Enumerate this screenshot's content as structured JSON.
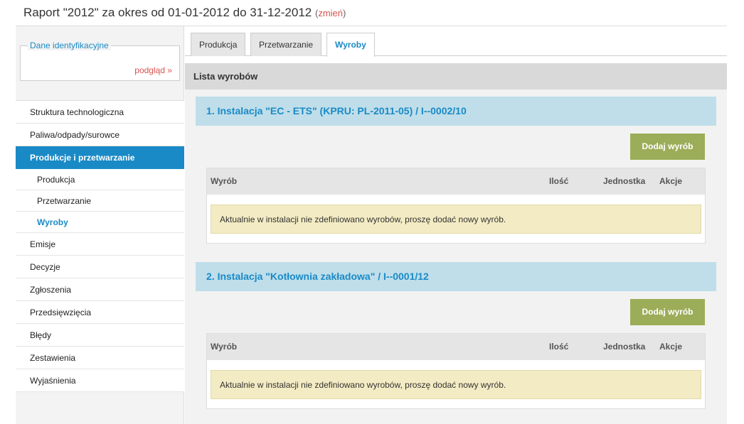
{
  "header": {
    "title": "Raport \"2012\" za okres od 01-01-2012 do 31-12-2012",
    "change_open": "(",
    "change_label": "zmień",
    "change_close": ")"
  },
  "sidebar": {
    "id_box": {
      "legend": "Dane identyfikacyjne",
      "preview_label": "podgląd »"
    },
    "items": [
      {
        "label": "Struktura technologiczna"
      },
      {
        "label": "Paliwa/odpady/surowce"
      },
      {
        "label": "Produkcje i przetwarzanie",
        "active": true
      },
      {
        "label": "Produkcja",
        "sub": true
      },
      {
        "label": "Przetwarzanie",
        "sub": true
      },
      {
        "label": "Wyroby",
        "sub": true,
        "current": true
      },
      {
        "label": "Emisje"
      },
      {
        "label": "Decyzje"
      },
      {
        "label": "Zgłoszenia"
      },
      {
        "label": "Przedsięwzięcia"
      },
      {
        "label": "Błędy"
      },
      {
        "label": "Zestawienia"
      },
      {
        "label": "Wyjaśnienia"
      }
    ]
  },
  "tabs": [
    {
      "label": "Produkcja"
    },
    {
      "label": "Przetwarzanie"
    },
    {
      "label": "Wyroby",
      "active": true
    }
  ],
  "list_header": "Lista wyrobów",
  "installations": [
    {
      "title": "1. Instalacja \"EC - ETS\" (KPRU: PL-2011-05) / I--0002/10",
      "add_button": "Dodaj wyrób",
      "columns": {
        "product": "Wyrób",
        "quantity": "Ilość",
        "unit": "Jednostka",
        "actions": "Akcje"
      },
      "empty_message": "Aktualnie w instalacji nie zdefiniowano wyrobów, proszę dodać nowy wyrób."
    },
    {
      "title": "2. Instalacja \"Kotłownia zakładowa\" / I--0001/12",
      "add_button": "Dodaj wyrób",
      "columns": {
        "product": "Wyrób",
        "quantity": "Ilość",
        "unit": "Jednostka",
        "actions": "Akcje"
      },
      "empty_message": "Aktualnie w instalacji nie zdefiniowano wyrobów, proszę dodać nowy wyrób."
    }
  ],
  "colors": {
    "accent": "#1a8ac6",
    "link_red": "#d9534f",
    "button_green": "#9bad58",
    "notice_bg": "#f3ebc3",
    "install_bg": "#bfdeea"
  }
}
